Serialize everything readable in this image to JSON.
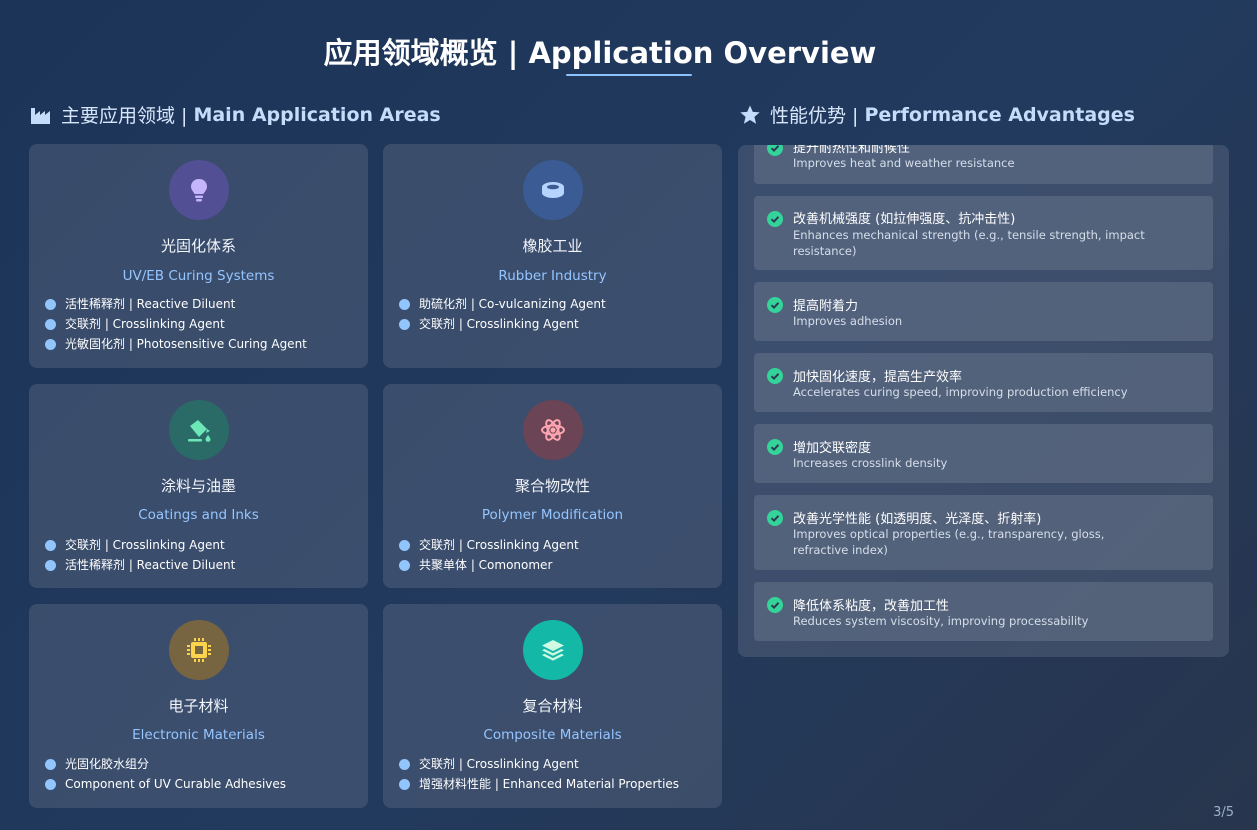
{
  "title": "应用领域概览 | Application Overview",
  "left_heading": {
    "zh": "主要应用领域 |",
    "en": "Main Application Areas",
    "icon": "industry-icon"
  },
  "right_heading": {
    "zh": "性能优势 |",
    "en": "Performance Advantages",
    "icon": "star-icon"
  },
  "colors": {
    "accent": "#8cc2ff",
    "bullet": "#93c5fd",
    "check": "#34d399"
  },
  "cards": [
    {
      "zh": "光固化体系",
      "en": "UV/EB Curing Systems",
      "icon": "lightbulb-icon",
      "icon_bg": "#524f95",
      "icon_color": "#c4b5fd",
      "items": [
        "活性稀释剂 | Reactive Diluent",
        "交联剂 | Crosslinking Agent",
        "光敏固化剂 | Photosensitive Curing Agent"
      ]
    },
    {
      "zh": "橡胶工业",
      "en": "Rubber Industry",
      "icon": "ring-icon",
      "icon_bg": "#3a5b93",
      "icon_color": "#b7d4ff",
      "items": [
        "助硫化剂 | Co-vulcanizing Agent",
        "交联剂 | Crosslinking Agent"
      ]
    },
    {
      "zh": "涂料与油墨",
      "en": "Coatings and Inks",
      "icon": "paint-bucket-icon",
      "icon_bg": "#2a6a67",
      "icon_color": "#6ee7b7",
      "items": [
        "交联剂 | Crosslinking Agent",
        "活性稀释剂 | Reactive Diluent"
      ]
    },
    {
      "zh": "聚合物改性",
      "en": "Polymer Modification",
      "icon": "atom-icon",
      "icon_bg": "#6b4456",
      "icon_color": "#fda4af",
      "items": [
        "交联剂 | Crosslinking Agent",
        "共聚单体 | Comonomer"
      ]
    },
    {
      "zh": "电子材料",
      "en": "Electronic Materials",
      "icon": "microchip-icon",
      "icon_bg": "#776542",
      "icon_color": "#fcd34d",
      "items": [
        "光固化胶水组分",
        "Component of UV Curable Adhesives"
      ]
    },
    {
      "zh": "复合材料",
      "en": "Composite Materials",
      "icon": "layers-icon",
      "icon_bg": "#14b8a6",
      "icon_color": "#d1fae5",
      "items": [
        "交联剂 | Crosslinking Agent",
        "增强材料性能 | Enhanced Material Properties"
      ]
    }
  ],
  "advantages": [
    {
      "zh": "提升耐热性和耐候性",
      "en": "Improves heat and weather resistance"
    },
    {
      "zh": "改善机械强度 (如拉伸强度、抗冲击性)",
      "en": "Enhances mechanical strength (e.g., tensile strength, impact resistance)"
    },
    {
      "zh": "提高附着力",
      "en": "Improves adhesion"
    },
    {
      "zh": "加快固化速度，提高生产效率",
      "en": "Accelerates curing speed, improving production efficiency"
    },
    {
      "zh": "增加交联密度",
      "en": "Increases crosslink density"
    },
    {
      "zh": "改善光学性能 (如透明度、光泽度、折射率)",
      "en": "Improves optical properties (e.g., transparency, gloss, refractive index)"
    },
    {
      "zh": "降低体系粘度，改善加工性",
      "en": "Reduces system viscosity, improving processability"
    }
  ],
  "page_number": "3/5"
}
